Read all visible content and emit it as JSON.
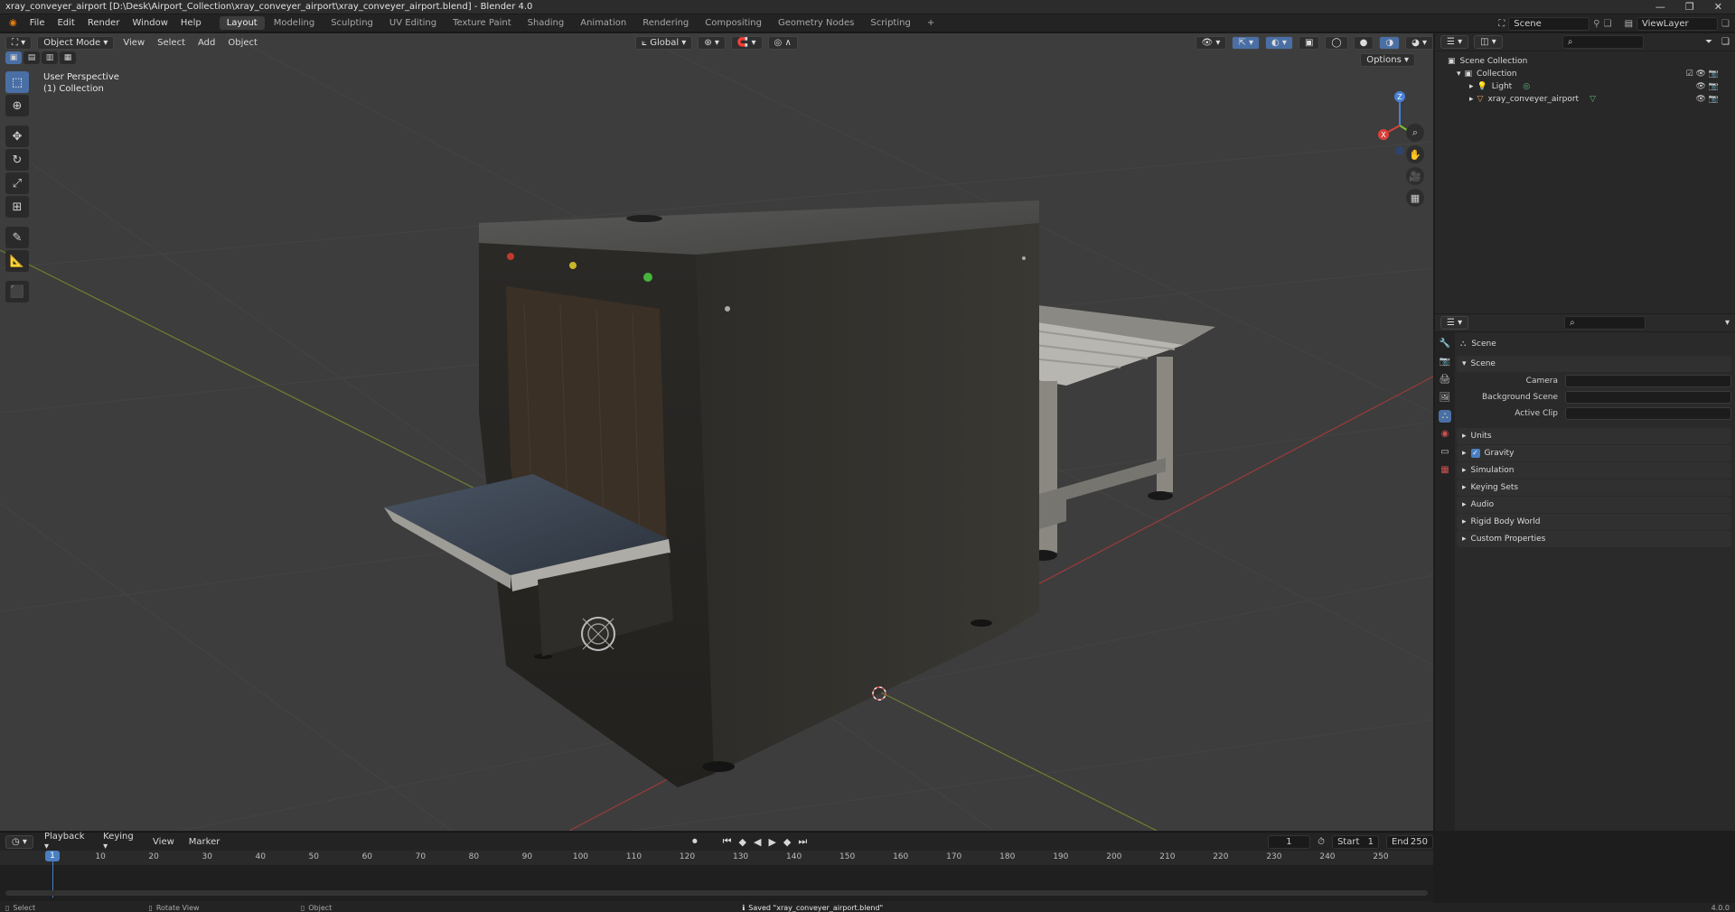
{
  "window": {
    "title": "xray_conveyer_airport [D:\\Desk\\Airport_Collection\\xray_conveyer_airport\\xray_conveyer_airport.blend] - Blender 4.0"
  },
  "menus": [
    "File",
    "Edit",
    "Render",
    "Window",
    "Help"
  ],
  "workspaces": [
    "Layout",
    "Modeling",
    "Sculpting",
    "UV Editing",
    "Texture Paint",
    "Shading",
    "Animation",
    "Rendering",
    "Compositing",
    "Geometry Nodes",
    "Scripting"
  ],
  "active_workspace": "Layout",
  "topbar_right": {
    "scene": "Scene",
    "view_layer": "ViewLayer"
  },
  "viewport": {
    "mode": "Object Mode",
    "menus": [
      "View",
      "Select",
      "Add",
      "Object"
    ],
    "orientation": "Global",
    "options_label": "Options",
    "info_line1": "User Perspective",
    "info_line2": "(1) Collection",
    "gizmo": {
      "z": "Z",
      "y": "Y",
      "x": "X"
    }
  },
  "timeline": {
    "menus": [
      "Playback",
      "Keying",
      "View",
      "Marker"
    ],
    "current_frame": "1",
    "start_label": "Start",
    "start": "1",
    "end_label": "End",
    "end": "250",
    "ruler": [
      "1",
      "10",
      "20",
      "30",
      "40",
      "50",
      "60",
      "70",
      "80",
      "90",
      "100",
      "110",
      "120",
      "130",
      "140",
      "150",
      "160",
      "170",
      "180",
      "190",
      "200",
      "210",
      "220",
      "230",
      "240",
      "250"
    ]
  },
  "outliner": {
    "root": "Scene Collection",
    "collection": "Collection",
    "items": [
      "Light",
      "xray_conveyer_airport"
    ]
  },
  "properties": {
    "context": "Scene",
    "section": "Scene",
    "fields": [
      {
        "label": "Camera"
      },
      {
        "label": "Background Scene"
      },
      {
        "label": "Active Clip"
      }
    ],
    "panels": [
      "Units",
      "Gravity",
      "Simulation",
      "Keying Sets",
      "Audio",
      "Rigid Body World",
      "Custom Properties"
    ]
  },
  "statusbar": {
    "select": "Select",
    "rotate": "Rotate View",
    "object": "Object",
    "message": "Saved \"xray_conveyer_airport.blend\"",
    "version": "4.0.0"
  }
}
